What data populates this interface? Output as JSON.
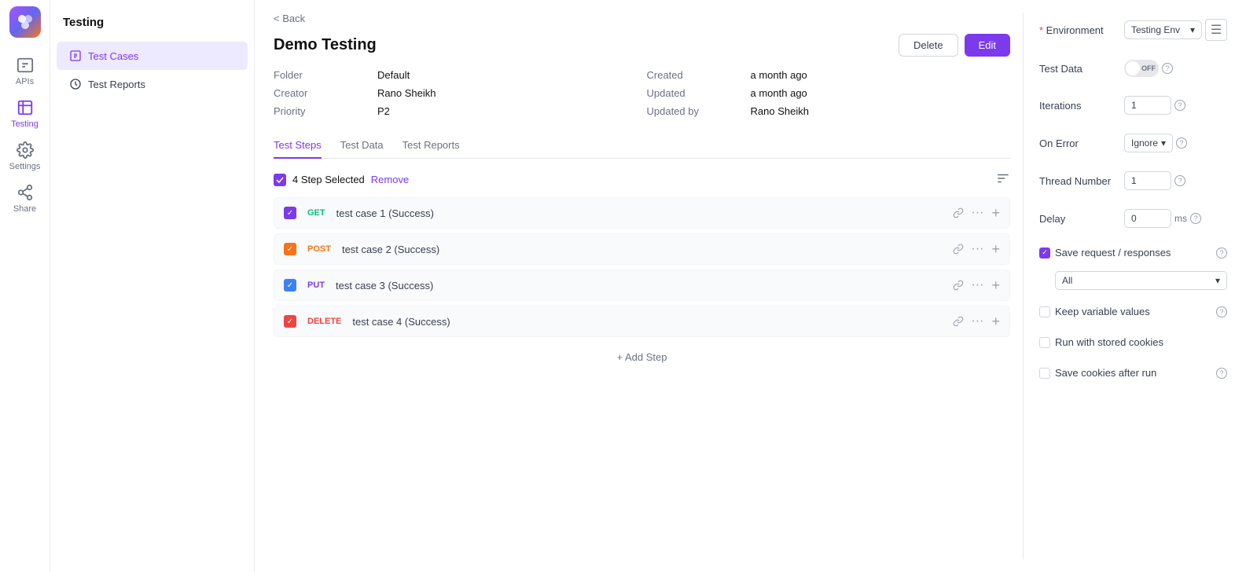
{
  "app": {
    "logo_alt": "App Logo"
  },
  "rail": {
    "items": [
      {
        "label": "APIs",
        "icon": "apis-icon",
        "active": false
      },
      {
        "label": "Testing",
        "icon": "testing-icon",
        "active": true
      },
      {
        "label": "Settings",
        "icon": "settings-icon",
        "active": false
      },
      {
        "label": "Share",
        "icon": "share-icon",
        "active": false
      }
    ]
  },
  "sidebar": {
    "title": "Testing",
    "items": [
      {
        "label": "Test Cases",
        "icon": "test-cases-icon",
        "active": true
      },
      {
        "label": "Test Reports",
        "icon": "test-reports-icon",
        "active": false
      }
    ]
  },
  "back": "< Back",
  "page": {
    "title": "Demo Testing",
    "meta": {
      "folder_label": "Folder",
      "folder_value": "Default",
      "creator_label": "Creator",
      "creator_value": "Rano Sheikh",
      "priority_label": "Priority",
      "priority_value": "P2",
      "created_label": "Created",
      "created_value": "a month ago",
      "updated_label": "Updated",
      "updated_value": "a month ago",
      "updated_by_label": "Updated by",
      "updated_by_value": "Rano Sheikh"
    },
    "buttons": {
      "delete": "Delete",
      "edit": "Edit"
    }
  },
  "tabs": [
    {
      "label": "Test Steps",
      "active": true
    },
    {
      "label": "Test Data",
      "active": false
    },
    {
      "label": "Test Reports",
      "active": false
    }
  ],
  "steps": {
    "selected_count": "4 Step Selected",
    "remove_label": "Remove",
    "add_step": "+ Add Step",
    "items": [
      {
        "method": "GET",
        "method_class": "method-get",
        "name": "test case 1 (Success)",
        "checkbox_class": "checked-purple"
      },
      {
        "method": "POST",
        "method_class": "method-post",
        "name": "test case 2 (Success)",
        "checkbox_class": "checked-orange"
      },
      {
        "method": "PUT",
        "method_class": "method-put",
        "name": "test case 3 (Success)",
        "checkbox_class": "checked-blue"
      },
      {
        "method": "DELETE",
        "method_class": "method-delete",
        "name": "test case 4 (Success)",
        "checkbox_class": "checked-red"
      }
    ]
  },
  "panel": {
    "environment_label": "Environment",
    "environment_value": "Testing Env",
    "test_data_label": "Test Data",
    "test_data_toggle": "OFF",
    "iterations_label": "Iterations",
    "iterations_value": "1",
    "on_error_label": "On Error",
    "on_error_value": "Ignore",
    "thread_number_label": "Thread Number",
    "thread_number_value": "1",
    "delay_label": "Delay",
    "delay_value": "0",
    "delay_unit": "ms",
    "save_requests_label": "Save request / responses",
    "save_requests_checked": true,
    "all_label": "All",
    "keep_variable_label": "Keep variable values",
    "run_stored_cookies_label": "Run with stored cookies",
    "save_cookies_label": "Save cookies after run"
  }
}
